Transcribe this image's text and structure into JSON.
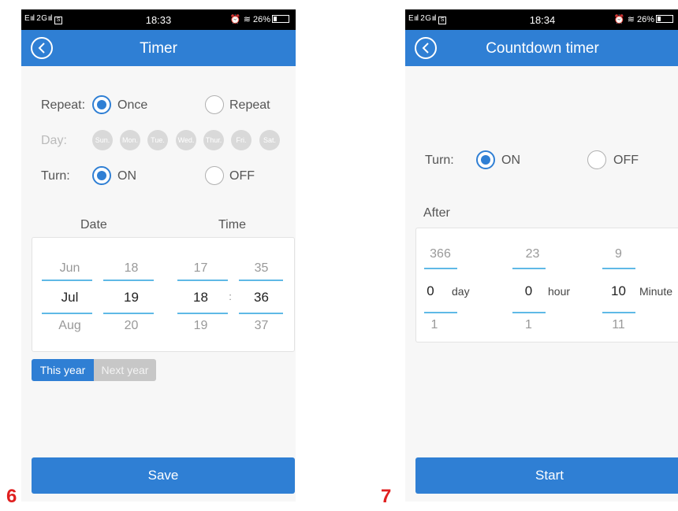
{
  "screens": {
    "timer": {
      "status": {
        "signal": "E … il 2G … il",
        "clock": "18:33",
        "battery": "26%"
      },
      "title": "Timer",
      "repeat": {
        "label": "Repeat:",
        "once": "Once",
        "repeat": "Repeat",
        "selected": "Once"
      },
      "day": {
        "label": "Day:",
        "days": [
          "Sun.",
          "Mon.",
          "Tue.",
          "Wed.",
          "Thur.",
          "Fri.",
          "Sat."
        ]
      },
      "turn": {
        "label": "Turn:",
        "on": "ON",
        "off": "OFF",
        "selected": "ON"
      },
      "headers": {
        "date": "Date",
        "time": "Time"
      },
      "picker": {
        "month": [
          "Jun",
          "Jul",
          "Aug"
        ],
        "day": [
          "18",
          "19",
          "20"
        ],
        "hour": [
          "17",
          "18",
          "19"
        ],
        "minute": [
          "35",
          "36",
          "37"
        ],
        "separator": ":"
      },
      "year_tabs": {
        "this_year": "This year",
        "next_year": "Next year",
        "selected": "This year"
      },
      "save": "Save",
      "step": "6"
    },
    "countdown": {
      "status": {
        "signal": "E il 2G il",
        "clock": "18:34",
        "battery": "26%"
      },
      "title": "Countdown timer",
      "turn": {
        "label": "Turn:",
        "on": "ON",
        "off": "OFF",
        "selected": "ON"
      },
      "after_label": "After",
      "picker": {
        "days": [
          "366",
          "0",
          "1"
        ],
        "hours": [
          "23",
          "0",
          "1"
        ],
        "minutes": [
          "9",
          "10",
          "11"
        ],
        "units": {
          "day": "day",
          "hour": "hour",
          "minute": "Minute"
        }
      },
      "start": "Start",
      "step": "7"
    }
  },
  "icons": {
    "back": "back-arrow-circle-icon",
    "alarm": "alarm-clock-icon",
    "wifi": "wifi-icon",
    "battery": "battery-icon",
    "sim": "sim-card-icon"
  },
  "colors": {
    "accent": "#2f7fd4",
    "picker_line": "#5fb9e6",
    "step_number": "#e02020"
  }
}
